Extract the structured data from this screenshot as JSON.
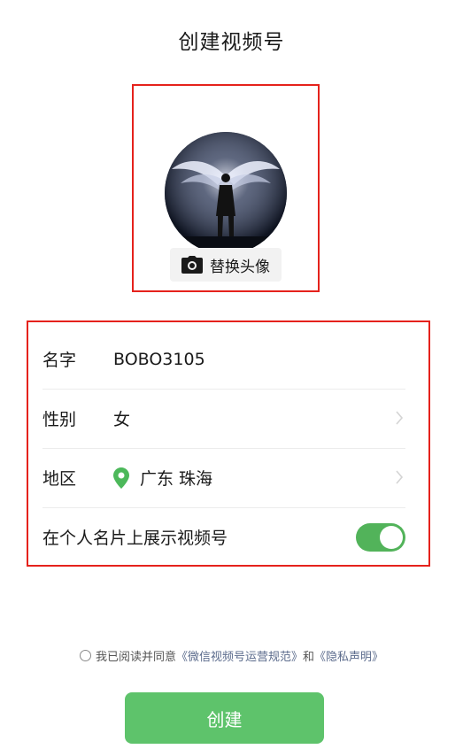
{
  "header": {
    "title": "创建视频号"
  },
  "avatar": {
    "replace_label": "替换头像"
  },
  "form": {
    "name": {
      "label": "名字",
      "value": "BOBO3105"
    },
    "gender": {
      "label": "性别",
      "value": "女"
    },
    "region": {
      "label": "地区",
      "value": "广东 珠海"
    },
    "show_on_card": {
      "label": "在个人名片上展示视频号",
      "enabled": true
    }
  },
  "agreement": {
    "prefix": "我已阅读并同意",
    "link1": "《微信视频号运营规范》",
    "conjunction": "和",
    "link2": "《隐私声明》",
    "checked": false
  },
  "create_button": {
    "label": "创建"
  },
  "colors": {
    "accent_green": "#5ec36b",
    "toggle_green": "#52b35a",
    "annotation_red": "#e5221c",
    "link_blue": "#5b6b8c"
  }
}
